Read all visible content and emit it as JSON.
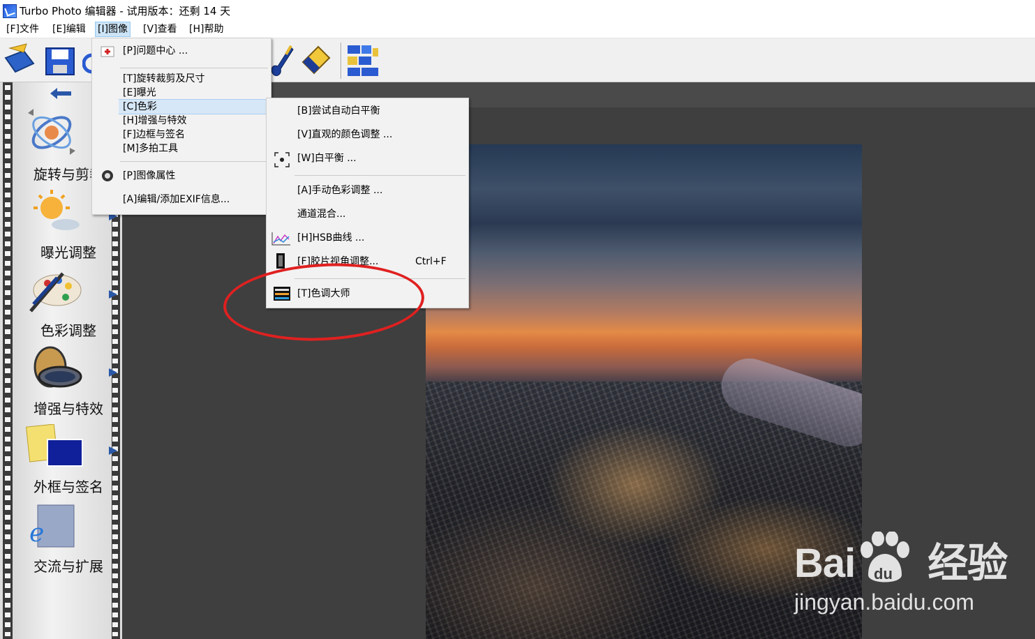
{
  "window": {
    "title": "Turbo Photo 编辑器  - 试用版本：还剩 14 天"
  },
  "menubar": [
    {
      "label": "[F]文件"
    },
    {
      "label": "[E]编辑"
    },
    {
      "label": "[I]图像"
    },
    {
      "label": "[V]查看"
    },
    {
      "label": "[H]帮助"
    }
  ],
  "toolbar": {
    "buttons": [
      "open-icon",
      "save-icon",
      "undo-icon",
      "paint-brush-icon",
      "eraser-icon",
      "layout-grid-icon"
    ]
  },
  "sidebar": {
    "back_icon": "left-arrow-icon",
    "items": [
      {
        "label": "旋转与剪裁",
        "icon": "rotate-crop-icon"
      },
      {
        "label": "曝光调整",
        "icon": "sun-exposure-icon"
      },
      {
        "label": "色彩调整",
        "icon": "palette-icon"
      },
      {
        "label": "增强与特效",
        "icon": "lens-filter-icon"
      },
      {
        "label": "外框与签名",
        "icon": "frame-signature-icon"
      },
      {
        "label": "交流与扩展",
        "icon": "ie-globe-icon"
      }
    ]
  },
  "image_menu": {
    "items": [
      {
        "label": "[P]问题中心 ...",
        "icon": "help-center-icon"
      },
      {
        "label": "[T]旋转裁剪及尺寸"
      },
      {
        "label": "[E]曝光"
      },
      {
        "label": "[C]色彩",
        "highlighted": true
      },
      {
        "label": "[H]增强与特效"
      },
      {
        "label": "[F]边框与签名"
      },
      {
        "label": "[M]多拍工具"
      },
      {
        "label": "[P]图像属性",
        "icon": "properties-icon"
      },
      {
        "label": "[A]编辑/添加EXIF信息..."
      }
    ]
  },
  "color_submenu": {
    "items": [
      {
        "label": "[B]尝试自动白平衡"
      },
      {
        "label": "[V]直观的颜色调整 ..."
      },
      {
        "label": "[W]白平衡 ...",
        "icon": "white-balance-icon"
      },
      {
        "label": "[A]手动色彩调整 ..."
      },
      {
        "label": "通道混合..."
      },
      {
        "label": "[H]HSB曲线 ...",
        "icon": "hsb-curve-icon"
      },
      {
        "label": "[F]胶片视角调整...",
        "shortcut": "Ctrl+F",
        "icon": "film-icon"
      },
      {
        "label": "[T]色调大师",
        "icon": "tone-master-icon"
      }
    ]
  },
  "annotation": {
    "color": "#e02020"
  },
  "watermark": {
    "logo": "Bai  经验",
    "logo_left": "Bai",
    "logo_right": "经验",
    "url": "jingyan.baidu.com"
  }
}
